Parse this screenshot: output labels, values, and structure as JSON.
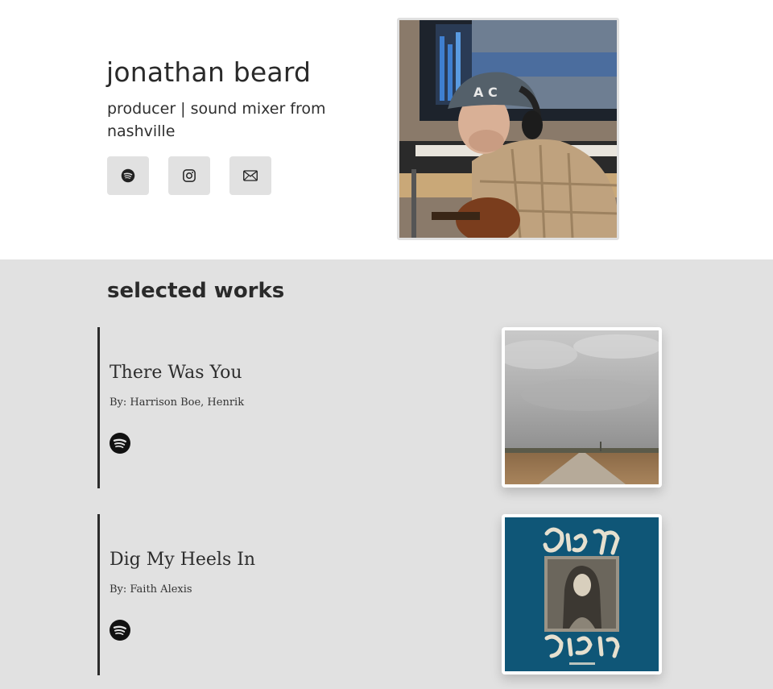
{
  "profile": {
    "name": "jonathan beard",
    "tagline": "producer | sound mixer from nashville"
  },
  "socials": [
    {
      "name": "spotify-link",
      "icon": "spotify-icon"
    },
    {
      "name": "instagram-link",
      "icon": "instagram-icon"
    },
    {
      "name": "email-link",
      "icon": "mail-icon"
    }
  ],
  "works": {
    "title": "selected works",
    "items": [
      {
        "title": "There Was You",
        "credit": "By: Harrison Boe, Henrik",
        "link_icon": "spotify-icon"
      },
      {
        "title": "Dig My Heels In",
        "credit": "By: Faith Alexis",
        "link_icon": "spotify-icon"
      }
    ]
  },
  "colors": {
    "hero_bg": "#ffffff",
    "section_bg": "#e1e1e1",
    "button_bg": "#e1e1e1",
    "text": "#2b2b2b",
    "accent_bar": "#2b2b2b",
    "album2_bg": "#0f5677"
  }
}
